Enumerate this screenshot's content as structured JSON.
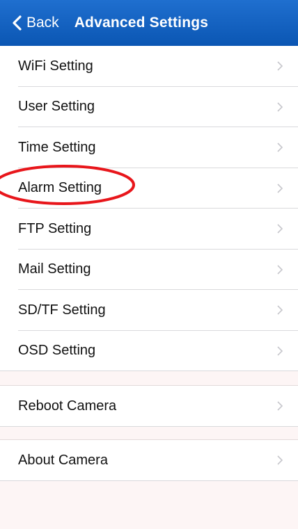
{
  "header": {
    "back_label": "Back",
    "title": "Advanced Settings",
    "back_icon": "chevron-left-icon",
    "background_color": "#0b5fc2"
  },
  "main": {
    "groups": [
      {
        "items": [
          {
            "label": "WiFi Setting"
          },
          {
            "label": "User Setting"
          },
          {
            "label": "Time Setting"
          },
          {
            "label": "Alarm Setting"
          },
          {
            "label": "FTP Setting"
          },
          {
            "label": "Mail Setting"
          },
          {
            "label": "SD/TF Setting"
          },
          {
            "label": "OSD Setting"
          }
        ]
      },
      {
        "items": [
          {
            "label": "Reboot Camera"
          }
        ]
      },
      {
        "items": [
          {
            "label": "About Camera"
          }
        ]
      }
    ],
    "row_icon": "chevron-right-icon"
  },
  "annotation": {
    "highlighted_item": "Alarm Setting",
    "color": "#e8161b"
  }
}
